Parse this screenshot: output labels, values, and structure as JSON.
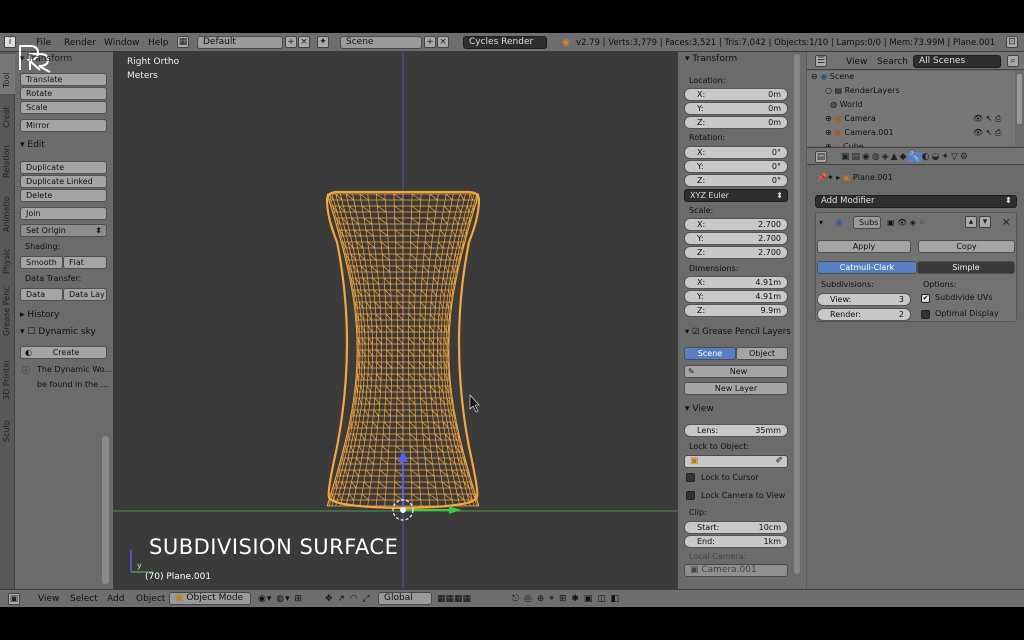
{
  "menu": {
    "items": [
      "File",
      "Render",
      "Window",
      "Help"
    ],
    "layout": "Default",
    "scene": "Scene",
    "engine": "Cycles Render",
    "stats": "v2.79 | Verts:3,779 | Faces:3,521 | Tris:7,042 | Objects:1/10 | Lamps:0/0 | Mem:73.99M | Plane.001"
  },
  "toolshelf": {
    "tabs": [
      "Tool",
      "Creat",
      "Relation",
      "Animatio",
      "Physic",
      "Grease Penc",
      "3D Printin",
      "Sculp"
    ],
    "transform": {
      "title": "Transform",
      "buttons": [
        "Translate",
        "Rotate",
        "Scale",
        "Mirror"
      ]
    },
    "edit": {
      "title": "Edit",
      "buttons": [
        "Duplicate",
        "Duplicate Linked",
        "Delete",
        "Join"
      ],
      "set_origin": "Set Origin",
      "shading_label": "Shading:",
      "smooth": "Smooth",
      "flat": "Flat",
      "data_transfer_label": "Data Transfer:",
      "data": "Data",
      "data_lay": "Data Lay"
    },
    "history": "History",
    "dynamic_sky": {
      "title": "Dynamic sky",
      "create": "Create",
      "info1": "The Dynamic Wo...",
      "info2": "be found in the ..."
    }
  },
  "viewport": {
    "view_name": "Right Ortho",
    "units": "Meters",
    "overlay_title": "SUBDIVISION SURFACE",
    "object_label": "(70) Plane.001",
    "axis": "y"
  },
  "npanel": {
    "transform_title": "Transform",
    "location_label": "Location:",
    "location": [
      {
        "axis": "X:",
        "value": "0m"
      },
      {
        "axis": "Y:",
        "value": "0m"
      },
      {
        "axis": "Z:",
        "value": "0m"
      }
    ],
    "rotation_label": "Rotation:",
    "rotation": [
      {
        "axis": "X:",
        "value": "0°"
      },
      {
        "axis": "Y:",
        "value": "0°"
      },
      {
        "axis": "Z:",
        "value": "0°"
      }
    ],
    "rotation_mode": "XYZ Euler",
    "scale_label": "Scale:",
    "scale": [
      {
        "axis": "X:",
        "value": "2.700"
      },
      {
        "axis": "Y:",
        "value": "2.700"
      },
      {
        "axis": "Z:",
        "value": "2.700"
      }
    ],
    "dimensions_label": "Dimensions:",
    "dimensions": [
      {
        "axis": "X:",
        "value": "4.91m"
      },
      {
        "axis": "Y:",
        "value": "4.91m"
      },
      {
        "axis": "Z:",
        "value": "9.9m"
      }
    ],
    "grease_title": "Grease Pencil Layers",
    "grease_scene": "Scene",
    "grease_object": "Object",
    "grease_new": "New",
    "grease_new_layer": "New Layer",
    "view_title": "View",
    "lens_label": "Lens:",
    "lens_value": "35mm",
    "lock_object_label": "Lock to Object:",
    "lock_cursor": "Lock to Cursor",
    "lock_camera": "Lock Camera to View",
    "clip_label": "Clip:",
    "clip_start_label": "Start:",
    "clip_start": "10cm",
    "clip_end_label": "End:",
    "clip_end": "1km",
    "local_camera_label": "Local Camera:",
    "local_camera": "Camera.001"
  },
  "outliner": {
    "view": "View",
    "search": "Search",
    "filter": "All Scenes",
    "items": [
      "Scene",
      "RenderLayers",
      "World",
      "Camera",
      "Camera.001",
      "Cube"
    ]
  },
  "properties": {
    "object_name": "Plane.001",
    "add_modifier": "Add Modifier",
    "modifier_name": "Subs",
    "apply": "Apply",
    "copy": "Copy",
    "catmull": "Catmull-Clark",
    "simple": "Simple",
    "subdivisions_label": "Subdivisions:",
    "view_label": "View:",
    "view_value": "3",
    "render_label": "Render:",
    "render_value": "2",
    "options_label": "Options:",
    "subdivide_uvs": "Subdivide UVs",
    "optimal_display": "Optimal Display"
  },
  "bottombar": {
    "menus": [
      "View",
      "Select",
      "Add",
      "Object"
    ],
    "mode": "Object Mode",
    "orientation": "Global"
  },
  "colors": {
    "wire": "#f4a63a",
    "selected_tab": "#5680c2",
    "grid_x": "#4a9a4a",
    "grid_y": "#5a5af0"
  }
}
